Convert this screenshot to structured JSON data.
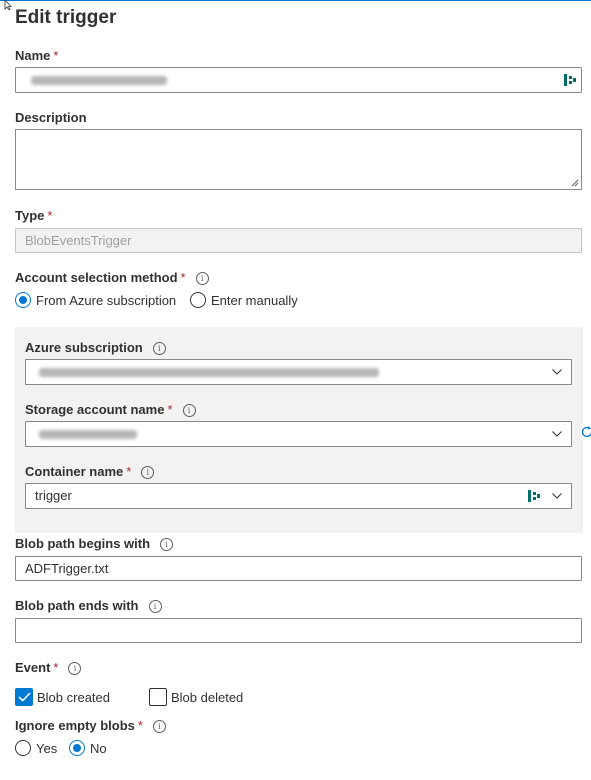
{
  "panel": {
    "title": "Edit trigger"
  },
  "name": {
    "label": "Name",
    "required": "*"
  },
  "description": {
    "label": "Description"
  },
  "type": {
    "label": "Type",
    "required": "*",
    "value": "BlobEventsTrigger"
  },
  "account_method": {
    "label": "Account selection method",
    "required": "*",
    "options": [
      "From Azure subscription",
      "Enter manually"
    ],
    "selected": "From Azure subscription"
  },
  "azure_subscription": {
    "label": "Azure subscription"
  },
  "storage_account": {
    "label": "Storage account name",
    "required": "*"
  },
  "container": {
    "label": "Container name",
    "required": "*",
    "value": "trigger"
  },
  "blob_begins": {
    "label": "Blob path begins with",
    "value": "ADFTrigger.txt"
  },
  "blob_ends": {
    "label": "Blob path ends with",
    "value": ""
  },
  "event": {
    "label": "Event",
    "required": "*",
    "options": [
      "Blob created",
      "Blob deleted"
    ],
    "checked": [
      "Blob created"
    ]
  },
  "ignore_empty": {
    "label": "Ignore empty blobs",
    "required": "*",
    "options": [
      "Yes",
      "No"
    ],
    "selected": "No"
  },
  "icons": {
    "info": "info-icon",
    "chevron": "chevron-down-icon",
    "database": "database-icon",
    "refresh": "refresh-icon",
    "cursor": "mouse-pointer-icon"
  },
  "colors": {
    "accent": "#0078d4",
    "required": "#a4262c",
    "panel_bg": "#f3f2f1",
    "db_icon": "#006d6a"
  }
}
